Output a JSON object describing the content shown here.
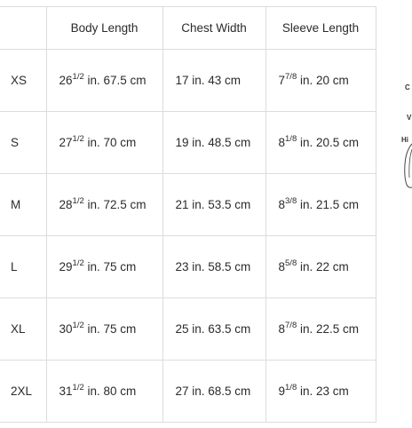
{
  "headers": [
    "",
    "Body Length",
    "Chest Width",
    "Sleeve Length"
  ],
  "rows": [
    {
      "size": "XS",
      "body": {
        "base": "26",
        "frac": "1/2",
        "rest": " in. 67.5 cm"
      },
      "chest": "17 in. 43 cm",
      "sleeve": {
        "base": "7",
        "frac": "7/8",
        "rest": " in. 20 cm"
      }
    },
    {
      "size": "S",
      "body": {
        "base": "27",
        "frac": "1/2",
        "rest": " in. 70 cm"
      },
      "chest": "19 in. 48.5 cm",
      "sleeve": {
        "base": "8",
        "frac": "1/8",
        "rest": " in. 20.5 cm"
      }
    },
    {
      "size": "M",
      "body": {
        "base": "28",
        "frac": "1/2",
        "rest": " in. 72.5 cm"
      },
      "chest": "21 in. 53.5 cm",
      "sleeve": {
        "base": "8",
        "frac": "3/8",
        "rest": " in. 21.5 cm"
      }
    },
    {
      "size": "L",
      "body": {
        "base": "29",
        "frac": "1/2",
        "rest": " in. 75 cm"
      },
      "chest": "23 in. 58.5 cm",
      "sleeve": {
        "base": "8",
        "frac": "5/8",
        "rest": " in. 22 cm"
      }
    },
    {
      "size": "XL",
      "body": {
        "base": "30",
        "frac": "1/2",
        "rest": " in. 75 cm"
      },
      "chest": "25 in. 63.5 cm",
      "sleeve": {
        "base": "8",
        "frac": "7/8",
        "rest": " in. 22.5 cm"
      }
    },
    {
      "size": "2XL",
      "body": {
        "base": "31",
        "frac": "1/2",
        "rest": " in. 80 cm"
      },
      "chest": "27 in. 68.5 cm",
      "sleeve": {
        "base": "9",
        "frac": "1/8",
        "rest": " in. 23 cm"
      }
    }
  ],
  "figure": {
    "labels": [
      "C",
      "V",
      "Hi"
    ]
  }
}
